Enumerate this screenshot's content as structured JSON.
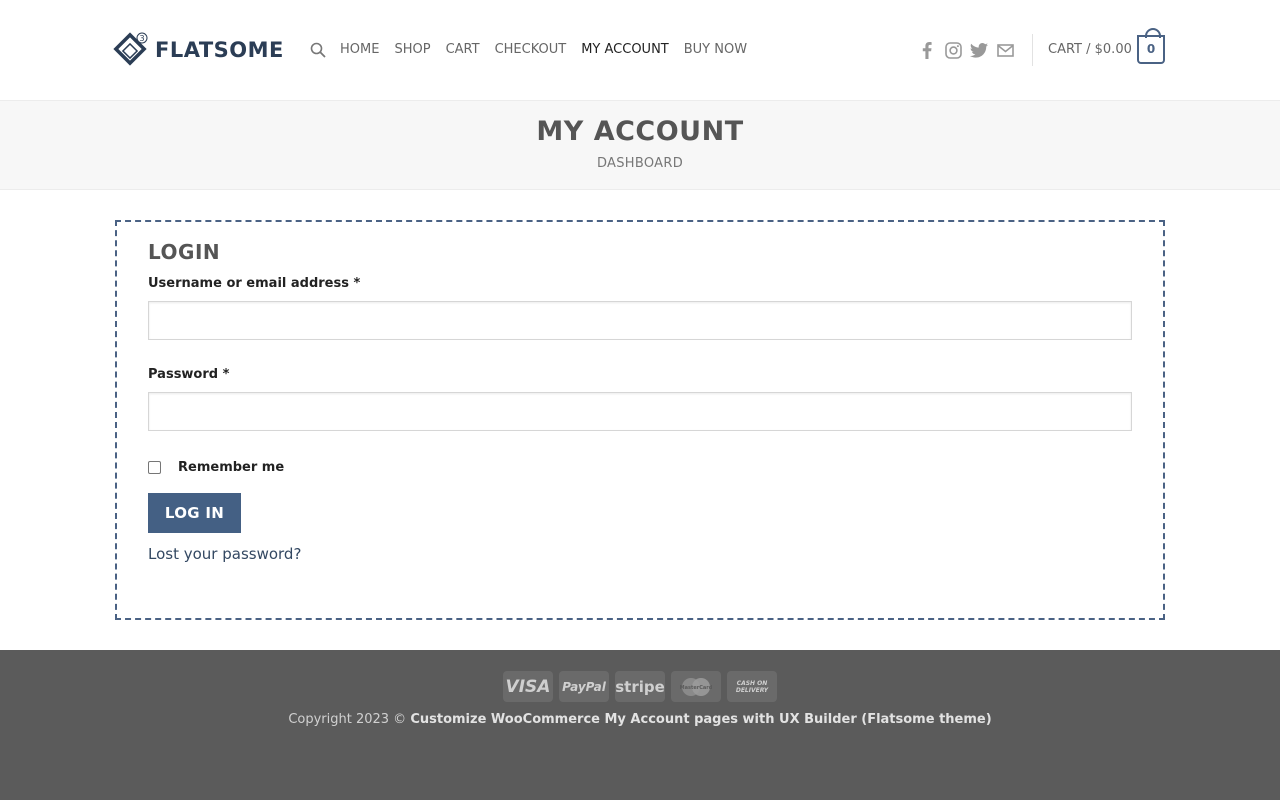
{
  "header": {
    "logo_text": "FLATSOME",
    "logo_badge": "3",
    "nav": [
      {
        "label": "HOME"
      },
      {
        "label": "SHOP"
      },
      {
        "label": "CART"
      },
      {
        "label": "CHECKOUT"
      },
      {
        "label": "MY ACCOUNT",
        "active": true
      },
      {
        "label": "BUY NOW"
      }
    ],
    "social_icons": [
      "facebook-icon",
      "instagram-icon",
      "twitter-icon",
      "email-icon"
    ],
    "cart_label": "CART / $0.00",
    "cart_count": "0"
  },
  "title_band": {
    "title": "MY ACCOUNT",
    "breadcrumb": "DASHBOARD"
  },
  "login": {
    "heading": "LOGIN",
    "username_label": "Username or email address",
    "password_label": "Password",
    "required_mark": "*",
    "username_value": "",
    "password_value": "",
    "remember_label": "Remember me",
    "remember_checked": false,
    "submit_label": "LOG IN",
    "lost_password": "Lost your password?"
  },
  "footer": {
    "payments": [
      "VISA",
      "PayPal",
      "stripe",
      "MasterCard",
      "CASH ON DELIVERY"
    ],
    "copyright_prefix": "Copyright 2023 ©",
    "copyright_site": "Customize WooCommerce My Account pages with UX Builder (Flatsome theme)"
  },
  "colors": {
    "primary": "#446084",
    "footer_bg": "#5b5b5b",
    "title_band_bg": "#f7f7f7"
  }
}
